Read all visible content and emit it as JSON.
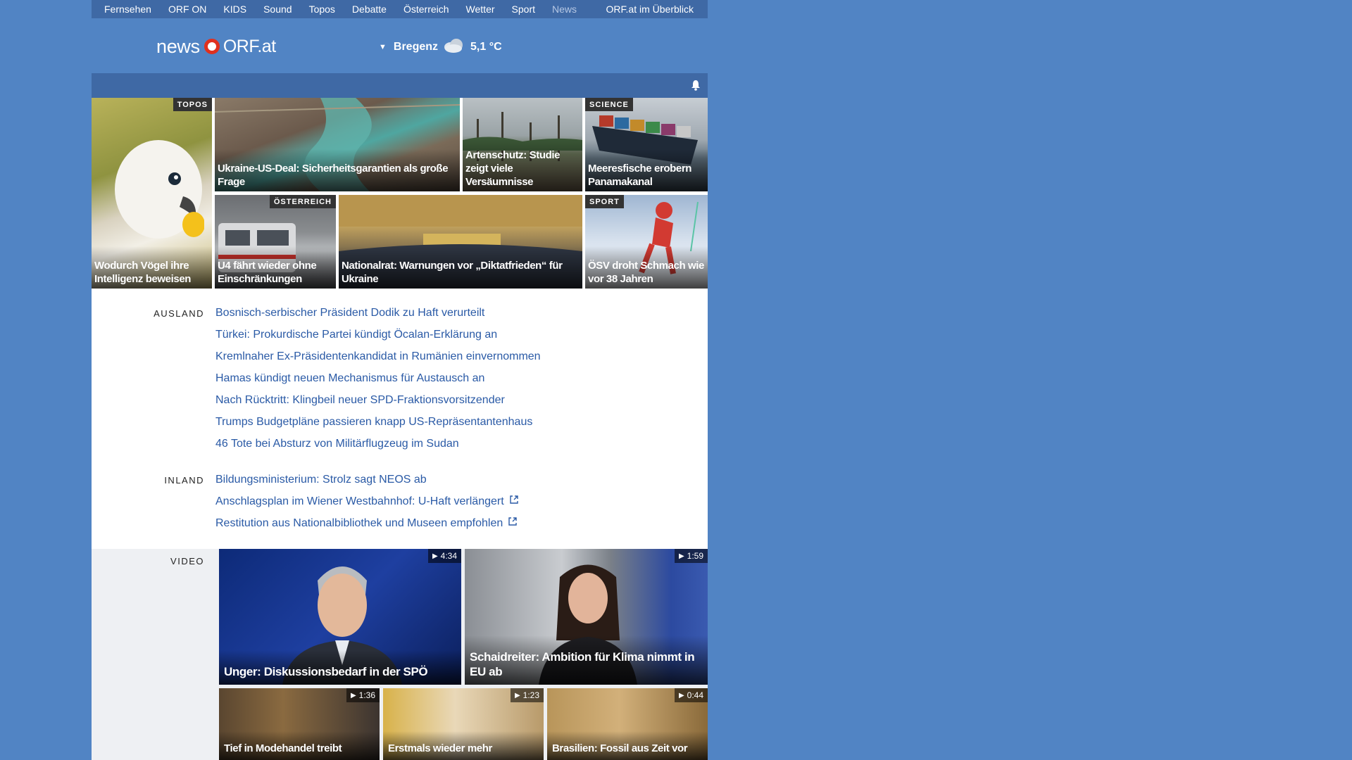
{
  "topnav": {
    "items": [
      "Fernsehen",
      "ORF ON",
      "KIDS",
      "Sound",
      "Topos",
      "Debatte",
      "Österreich",
      "Wetter",
      "Sport",
      "News"
    ],
    "overview": "ORF.at im Überblick"
  },
  "header": {
    "logo_news": "news",
    "logo_orf": "ORF.at",
    "location": "Bregenz",
    "temperature": "5,1 °C",
    "weather_icon": "cloud-icon"
  },
  "colors": {
    "background": "#5184c4",
    "nav": "#3f69a5",
    "link": "#2a5aa6",
    "logo_ring": "#e0301e"
  },
  "tiles": [
    {
      "tag": "TOPOS",
      "title": "Wodurch Vögel ihre Intelligenz beweisen"
    },
    {
      "tag": "",
      "title": "Ukraine-US-Deal: Sicherheitsgarantien als große Frage"
    },
    {
      "tag": "",
      "title": "Artenschutz: Studie zeigt viele Versäumnisse"
    },
    {
      "tag": "SCIENCE",
      "title": "Meeresfische erobern Panamakanal"
    },
    {
      "tag": "ÖSTERREICH",
      "title": "U4 fährt wieder ohne Einschränkungen"
    },
    {
      "tag": "",
      "title": "Nationalrat: Warnungen vor „Diktatfrieden“ für Ukraine"
    },
    {
      "tag": "SPORT",
      "title": "ÖSV droht Schmach wie vor 38 Jahren"
    }
  ],
  "ausland": {
    "label": "AUSLAND",
    "items": [
      "Bosnisch-serbischer Präsident Dodik zu Haft verurteilt",
      "Türkei: Prokurdische Partei kündigt Öcalan-Erklärung an",
      "Kremlnaher Ex-Präsidentenkandidat in Rumänien einvernommen",
      "Hamas kündigt neuen Mechanismus für Austausch an",
      "Nach Rücktritt: Klingbeil neuer SPD-Fraktionsvorsitzender",
      "Trumps Budgetpläne passieren knapp US-Repräsentantenhaus",
      "46 Tote bei Absturz von Militärflugzeug im Sudan"
    ]
  },
  "inland": {
    "label": "INLAND",
    "items": [
      "Bildungsministerium: Strolz sagt NEOS ab",
      "Anschlagsplan im Wiener Westbahnhof: U-Haft verlängert",
      "Restitution aus Nationalbibliothek und Museen empfohlen"
    ]
  },
  "video": {
    "label": "VIDEO",
    "items": [
      {
        "duration": "4:34",
        "title": "Unger: Diskussionsbedarf in der SPÖ"
      },
      {
        "duration": "1:59",
        "title": "Schaidreiter: Ambition für Klima nimmt in EU ab"
      },
      {
        "duration": "1:36",
        "title": "Tief in Modehandel treibt"
      },
      {
        "duration": "1:23",
        "title": "Erstmals wieder mehr"
      },
      {
        "duration": "0:44",
        "title": "Brasilien: Fossil aus Zeit vor"
      }
    ]
  }
}
